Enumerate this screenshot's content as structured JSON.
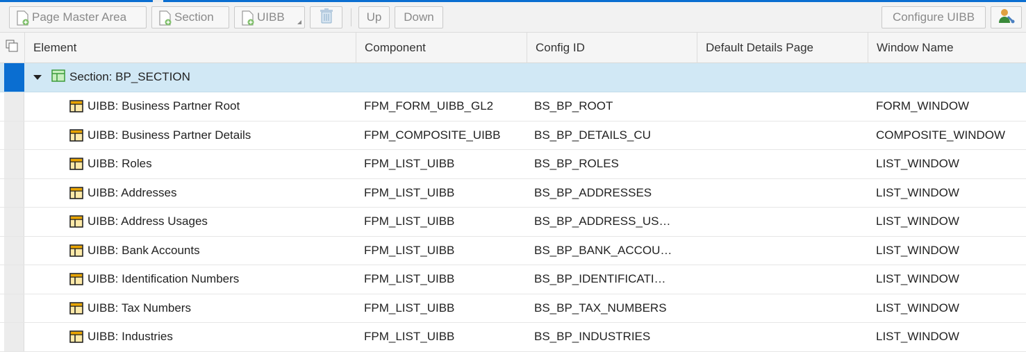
{
  "toolbar": {
    "page_master_area": "Page Master Area",
    "section": "Section",
    "uibb": "UIBB",
    "up": "Up",
    "down": "Down",
    "configure_uibb": "Configure UIBB"
  },
  "table": {
    "columns": [
      "Element",
      "Component",
      "Config ID",
      "Default Details Page",
      "Window Name"
    ],
    "section_row": {
      "label": "Section: BP_SECTION"
    },
    "rows": [
      {
        "element": "UIBB: Business Partner Root",
        "component": "FPM_FORM_UIBB_GL2",
        "config_id": "BS_BP_ROOT",
        "details": "",
        "window": "FORM_WINDOW"
      },
      {
        "element": "UIBB: Business Partner Details",
        "component": "FPM_COMPOSITE_UIBB",
        "config_id": "BS_BP_DETAILS_CU",
        "details": "",
        "window": "COMPOSITE_WINDOW"
      },
      {
        "element": "UIBB: Roles",
        "component": "FPM_LIST_UIBB",
        "config_id": "BS_BP_ROLES",
        "details": "",
        "window": "LIST_WINDOW"
      },
      {
        "element": "UIBB: Addresses",
        "component": "FPM_LIST_UIBB",
        "config_id": "BS_BP_ADDRESSES",
        "details": "",
        "window": "LIST_WINDOW"
      },
      {
        "element": "UIBB: Address Usages",
        "component": "FPM_LIST_UIBB",
        "config_id": "BS_BP_ADDRESS_US…",
        "details": "",
        "window": "LIST_WINDOW"
      },
      {
        "element": "UIBB: Bank Accounts",
        "component": "FPM_LIST_UIBB",
        "config_id": "BS_BP_BANK_ACCOU…",
        "details": "",
        "window": "LIST_WINDOW"
      },
      {
        "element": "UIBB: Identification Numbers",
        "component": "FPM_LIST_UIBB",
        "config_id": "BS_BP_IDENTIFICATI…",
        "details": "",
        "window": "LIST_WINDOW"
      },
      {
        "element": "UIBB: Tax Numbers",
        "component": "FPM_LIST_UIBB",
        "config_id": "BS_BP_TAX_NUMBERS",
        "details": "",
        "window": "LIST_WINDOW"
      },
      {
        "element": "UIBB: Industries",
        "component": "FPM_LIST_UIBB",
        "config_id": "BS_BP_INDUSTRIES",
        "details": "",
        "window": "LIST_WINDOW"
      }
    ]
  },
  "colors": {
    "accent": "#0a6ed1",
    "section_row_bg": "#d1e8f5",
    "uibb_icon": "#e9a400",
    "section_icon": "#3a9a3a"
  }
}
